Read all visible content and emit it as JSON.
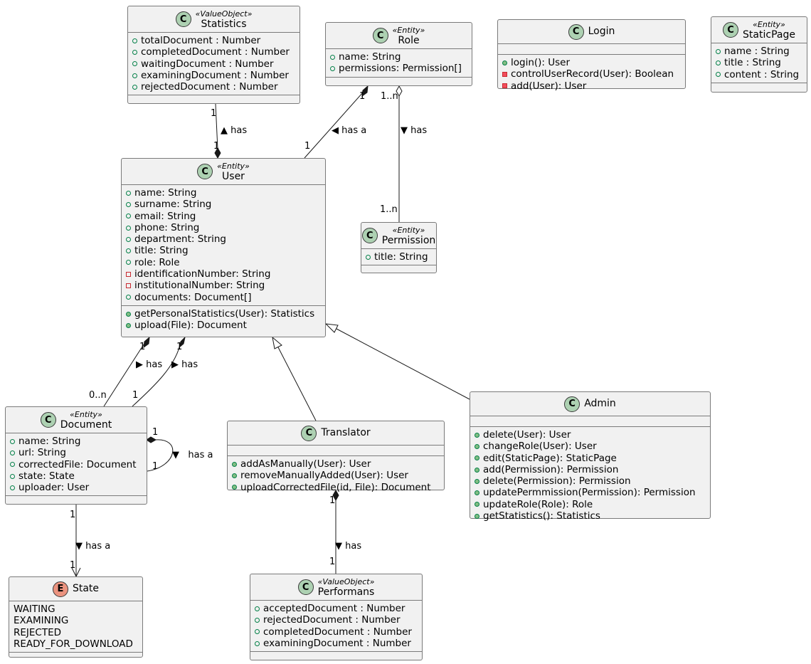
{
  "classes": {
    "statistics": {
      "stereotype": "«ValueObject»",
      "name": "Statistics",
      "kind": "class",
      "fields": [
        {
          "vis": "public",
          "text": "totalDocument : Number"
        },
        {
          "vis": "public",
          "text": "completedDocument : Number"
        },
        {
          "vis": "public",
          "text": "waitingDocument : Number"
        },
        {
          "vis": "public",
          "text": "examiningDocument : Number"
        },
        {
          "vis": "public",
          "text": "rejectedDocument : Number"
        }
      ],
      "methods": []
    },
    "role": {
      "stereotype": "«Entity»",
      "name": "Role",
      "kind": "class",
      "fields": [
        {
          "vis": "public",
          "text": "name: String"
        },
        {
          "vis": "public",
          "text": "permissions: Permission[]"
        }
      ],
      "methods": []
    },
    "login": {
      "stereotype": "",
      "name": "Login",
      "kind": "class",
      "fields": [],
      "methods": [
        {
          "vis": "public",
          "text": "login(): User"
        },
        {
          "vis": "private",
          "text": "controlUserRecord(User): Boolean"
        },
        {
          "vis": "private",
          "text": "add(User): User"
        }
      ]
    },
    "staticpage": {
      "stereotype": "«Entity»",
      "name": "StaticPage",
      "kind": "class",
      "fields": [
        {
          "vis": "public",
          "text": "name : String"
        },
        {
          "vis": "public",
          "text": "title : String"
        },
        {
          "vis": "public",
          "text": "content : String"
        }
      ],
      "methods": []
    },
    "user": {
      "stereotype": "«Entity»",
      "name": "User",
      "kind": "class",
      "fields": [
        {
          "vis": "public",
          "text": "name: String"
        },
        {
          "vis": "public",
          "text": "surname: String"
        },
        {
          "vis": "public",
          "text": "email: String"
        },
        {
          "vis": "public",
          "text": "phone: String"
        },
        {
          "vis": "public",
          "text": "department: String"
        },
        {
          "vis": "public",
          "text": "title: String"
        },
        {
          "vis": "public",
          "text": "role: Role"
        },
        {
          "vis": "private",
          "text": "identificationNumber: String"
        },
        {
          "vis": "private",
          "text": "institutionalNumber: String"
        },
        {
          "vis": "public",
          "text": "documents: Document[]"
        }
      ],
      "methods": [
        {
          "vis": "public",
          "text": "getPersonalStatistics(User): Statistics"
        },
        {
          "vis": "public",
          "text": "upload(File): Document"
        }
      ]
    },
    "permission": {
      "stereotype": "«Entity»",
      "name": "Permission",
      "kind": "class",
      "fields": [
        {
          "vis": "public",
          "text": "title: String"
        }
      ],
      "methods": []
    },
    "document": {
      "stereotype": "«Entity»",
      "name": "Document",
      "kind": "class",
      "fields": [
        {
          "vis": "public",
          "text": "name: String"
        },
        {
          "vis": "public",
          "text": "url: String"
        },
        {
          "vis": "public",
          "text": "correctedFile: Document"
        },
        {
          "vis": "public",
          "text": "state: State"
        },
        {
          "vis": "public",
          "text": "uploader: User"
        }
      ],
      "methods": []
    },
    "translator": {
      "stereotype": "",
      "name": "Translator",
      "kind": "class",
      "fields": [],
      "methods": [
        {
          "vis": "public",
          "text": "addAsManually(User): User"
        },
        {
          "vis": "public",
          "text": "removeManuallyAdded(User): User"
        },
        {
          "vis": "public",
          "text": "uploadCorrectedFile(id, File): Document"
        }
      ]
    },
    "admin": {
      "stereotype": "",
      "name": "Admin",
      "kind": "class",
      "fields": [],
      "methods": [
        {
          "vis": "public",
          "text": "delete(User): User"
        },
        {
          "vis": "public",
          "text": "changeRole(User): User"
        },
        {
          "vis": "public",
          "text": "edit(StaticPage): StaticPage"
        },
        {
          "vis": "public",
          "text": "add(Permission): Permission"
        },
        {
          "vis": "public",
          "text": "delete(Permission): Permission"
        },
        {
          "vis": "public",
          "text": "updatePermmission(Permission): Permission"
        },
        {
          "vis": "public",
          "text": "updateRole(Role): Role"
        },
        {
          "vis": "public",
          "text": "getStatistics(): Statistics"
        }
      ]
    },
    "state": {
      "stereotype": "",
      "name": "State",
      "kind": "enum",
      "values": [
        "WAITING",
        "EXAMINING",
        "REJECTED",
        "READY_FOR_DOWNLOAD"
      ]
    },
    "performans": {
      "stereotype": "«ValueObject»",
      "name": "Performans",
      "kind": "class",
      "fields": [
        {
          "vis": "public",
          "text": "acceptedDocument : Number"
        },
        {
          "vis": "public",
          "text": "rejectedDocument : Number"
        },
        {
          "vis": "public",
          "text": "completedDocument : Number"
        },
        {
          "vis": "public",
          "text": "examiningDocument : Number"
        }
      ],
      "methods": []
    }
  },
  "badges": {
    "class": "C",
    "enum": "E"
  },
  "relations": [
    {
      "id": "stats-user",
      "from": "Statistics",
      "to": "User",
      "type": "composition",
      "label": "has",
      "direction": "▲",
      "mult_from": "1",
      "mult_to": "1"
    },
    {
      "id": "role-user",
      "from": "Role",
      "to": "User",
      "type": "composition",
      "label": "has a",
      "direction": "◀",
      "mult_from": "1",
      "mult_to": "1"
    },
    {
      "id": "role-permission",
      "from": "Role",
      "to": "Permission",
      "type": "aggregation",
      "label": "has",
      "direction": "▼",
      "mult_from": "1..n",
      "mult_to": "1..n"
    },
    {
      "id": "user-document-a",
      "from": "User",
      "to": "Document",
      "type": "composition",
      "label": "has",
      "direction": "▶",
      "mult_from": "1",
      "mult_to": "0..n"
    },
    {
      "id": "user-document-b",
      "from": "User",
      "to": "Document",
      "type": "composition",
      "label": "has",
      "direction": "▶",
      "mult_from": "1",
      "mult_to": "1"
    },
    {
      "id": "document-self",
      "from": "Document",
      "to": "Document",
      "type": "composition",
      "label": "has a",
      "direction": "▼",
      "mult_from": "1",
      "mult_to": "1"
    },
    {
      "id": "translator-user",
      "from": "Translator",
      "to": "User",
      "type": "inheritance",
      "label": "",
      "direction": "",
      "mult_from": "",
      "mult_to": ""
    },
    {
      "id": "admin-user",
      "from": "Admin",
      "to": "User",
      "type": "inheritance",
      "label": "",
      "direction": "",
      "mult_from": "",
      "mult_to": ""
    },
    {
      "id": "document-state",
      "from": "Document",
      "to": "State",
      "type": "association",
      "label": "has a",
      "direction": "▼",
      "mult_from": "1",
      "mult_to": "1"
    },
    {
      "id": "translator-performans",
      "from": "Translator",
      "to": "Performans",
      "type": "composition",
      "label": "has",
      "direction": "▼",
      "mult_from": "1",
      "mult_to": "1"
    }
  ]
}
